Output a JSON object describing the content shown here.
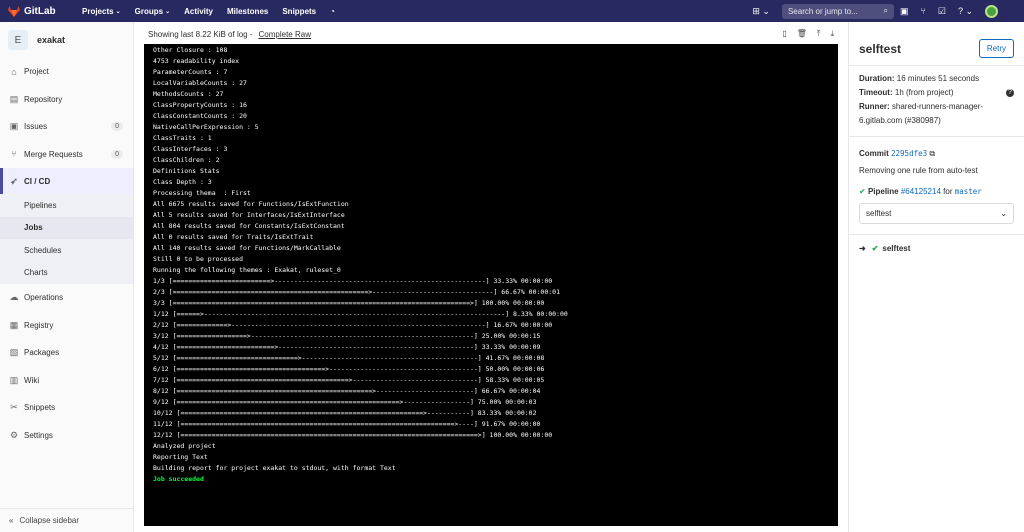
{
  "topnav": {
    "brand": "GitLab",
    "items": [
      {
        "label": "Projects",
        "dropdown": true
      },
      {
        "label": "Groups",
        "dropdown": true
      },
      {
        "label": "Activity",
        "dropdown": false
      },
      {
        "label": "Milestones",
        "dropdown": false
      },
      {
        "label": "Snippets",
        "dropdown": false
      }
    ],
    "search_placeholder": "Search or jump to..."
  },
  "sidebar": {
    "project_initial": "E",
    "project_name": "exakat",
    "items": [
      {
        "label": "Project",
        "icon": "home-icon"
      },
      {
        "label": "Repository",
        "icon": "doc-icon"
      },
      {
        "label": "Issues",
        "icon": "issues-icon",
        "badge": "0"
      },
      {
        "label": "Merge Requests",
        "icon": "merge-icon",
        "badge": "0"
      }
    ],
    "active": {
      "label": "CI / CD",
      "icon": "rocket-icon"
    },
    "subitems": [
      "Pipelines",
      "Jobs",
      "Schedules",
      "Charts"
    ],
    "items_after": [
      {
        "label": "Operations",
        "icon": "cloud-icon"
      },
      {
        "label": "Registry",
        "icon": "box-icon"
      },
      {
        "label": "Packages",
        "icon": "package-icon"
      },
      {
        "label": "Wiki",
        "icon": "book-icon"
      },
      {
        "label": "Snippets",
        "icon": "scissors-icon"
      },
      {
        "label": "Settings",
        "icon": "gear-icon"
      }
    ],
    "collapse_label": "Collapse sidebar"
  },
  "log": {
    "header": "Showing last 8.22 KiB of log -",
    "raw_label": "Complete Raw",
    "lines": [
      "Other Closure : 108",
      "4753 readability index",
      "ParameterCounts : 7",
      "LocalVariableCounts : 27",
      "MethodsCounts : 27",
      "ClassPropertyCounts : 16",
      "ClassConstantCounts : 20",
      "NativeCallPerExpression : 5",
      "ClassTraits : 1",
      "ClassInterfaces : 3",
      "ClassChildren : 2",
      "Definitions Stats",
      "Class Depth : 3",
      "Processing thema  : First",
      "All 6675 results saved for Functions/IsExtFunction",
      "All 5 results saved for Interfaces/IsExtInterface",
      "All 804 results saved for Constants/IsExtConstant",
      "All 0 results saved for Traits/IsExtTrait",
      "All 140 results saved for Functions/MarkCallable",
      "Still 0 to be processed",
      "Running the following themes : Exakat, ruleset_0",
      "1/3 [=========================>------------------------------------------------------] 33.33% 00:00:00",
      "2/3 [==================================================>-------------------------------] 66.67% 00:00:01",
      "3/3 [============================================================================>] 100.00% 00:00:00",
      "1/12 [======>-----------------------------------------------------------------------------] 8.33% 00:00:00",
      "2/12 [=============>-----------------------------------------------------------------] 16.67% 00:00:00",
      "3/12 [==================>---------------------------------------------------------] 25.00% 00:00:15",
      "4/12 [=========================>--------------------------------------------------] 33.33% 00:00:09",
      "5/12 [===============================>---------------------------------------------] 41.67% 00:00:08",
      "6/12 [======================================>--------------------------------------] 50.00% 00:00:06",
      "7/12 [============================================>--------------------------------] 58.33% 00:00:05",
      "8/12 [==================================================>-------------------------] 66.67% 00:00:04",
      "9/12 [=========================================================>-----------------] 75.00% 00:00:03",
      "10/12 [==============================================================>-----------] 83.33% 00:00:02",
      "11/12 [======================================================================>----] 91.67% 00:00:00",
      "12/12 [============================================================================>] 100.00% 00:00:00",
      "Analyzed project",
      "Reporting Text",
      "Building report for project exakat to stdout, with format Text"
    ],
    "success_line": "Job succeeded"
  },
  "job": {
    "title": "selftest",
    "retry_label": "Retry",
    "duration_label": "Duration:",
    "duration": "16 minutes 51 seconds",
    "timeout_label": "Timeout:",
    "timeout": "1h (from project)",
    "runner_label": "Runner:",
    "runner": "shared-runners-manager-6.gitlab.com (#380987)",
    "commit_label": "Commit",
    "commit_sha": "2295dfe3",
    "commit_message": "Removing one rule from auto-test",
    "pipeline_label": "Pipeline",
    "pipeline_id": "#64125214",
    "pipeline_for": "for",
    "branch": "master",
    "stage": "selftest",
    "job_name": "selftest"
  },
  "colors": {
    "nav": "#292961",
    "accent": "#1068bf",
    "success": "#1aaa55",
    "terminal_success": "#00ff3c"
  }
}
